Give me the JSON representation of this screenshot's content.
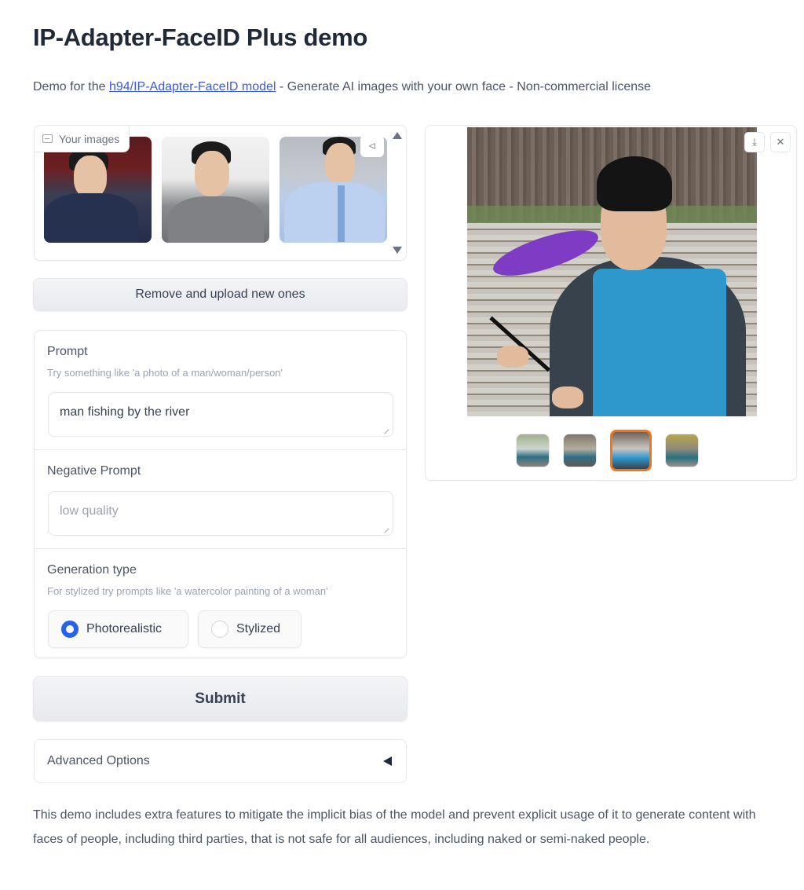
{
  "header": {
    "title": "IP-Adapter-FaceID Plus demo",
    "subtitle_prefix": "Demo for the ",
    "subtitle_link": "h94/IP-Adapter-FaceID model",
    "subtitle_suffix": " - Generate AI images with your own face - Non-commercial license"
  },
  "input_gallery": {
    "label": "Your images",
    "label_icon": "image-icon",
    "share_icon": "share-icon",
    "images": [
      {
        "alt": "man speaking into microphone in dark jacket"
      },
      {
        "alt": "man in grey hoodie"
      },
      {
        "alt": "man in light blue shirt and tie"
      }
    ]
  },
  "buttons": {
    "remove_upload": "Remove and upload new ones",
    "submit": "Submit"
  },
  "prompt": {
    "label": "Prompt",
    "info": "Try something like 'a photo of a man/woman/person'",
    "value": "man fishing by the river"
  },
  "negative_prompt": {
    "label": "Negative Prompt",
    "value": "",
    "placeholder": "low quality"
  },
  "generation_type": {
    "label": "Generation type",
    "info": "For stylized try prompts like 'a watercolor painting of a woman'",
    "options": [
      {
        "label": "Photorealistic",
        "selected": true
      },
      {
        "label": "Stylized",
        "selected": false
      }
    ]
  },
  "advanced": {
    "label": "Advanced Options",
    "state": "collapsed"
  },
  "disclaimer": "This demo includes extra features to mitigate the implicit bias of the model and prevent explicit usage of it to generate content with faces of people, including third parties, that is not safe for all audiences, including naked or semi-naked people.",
  "output_gallery": {
    "main_image_alt": "man fishing by the river in blue waders",
    "download_icon": "download-icon",
    "close_icon": "close-icon",
    "thumbnails_count": 4,
    "selected_index": 2,
    "selected_color": "#f97316"
  }
}
